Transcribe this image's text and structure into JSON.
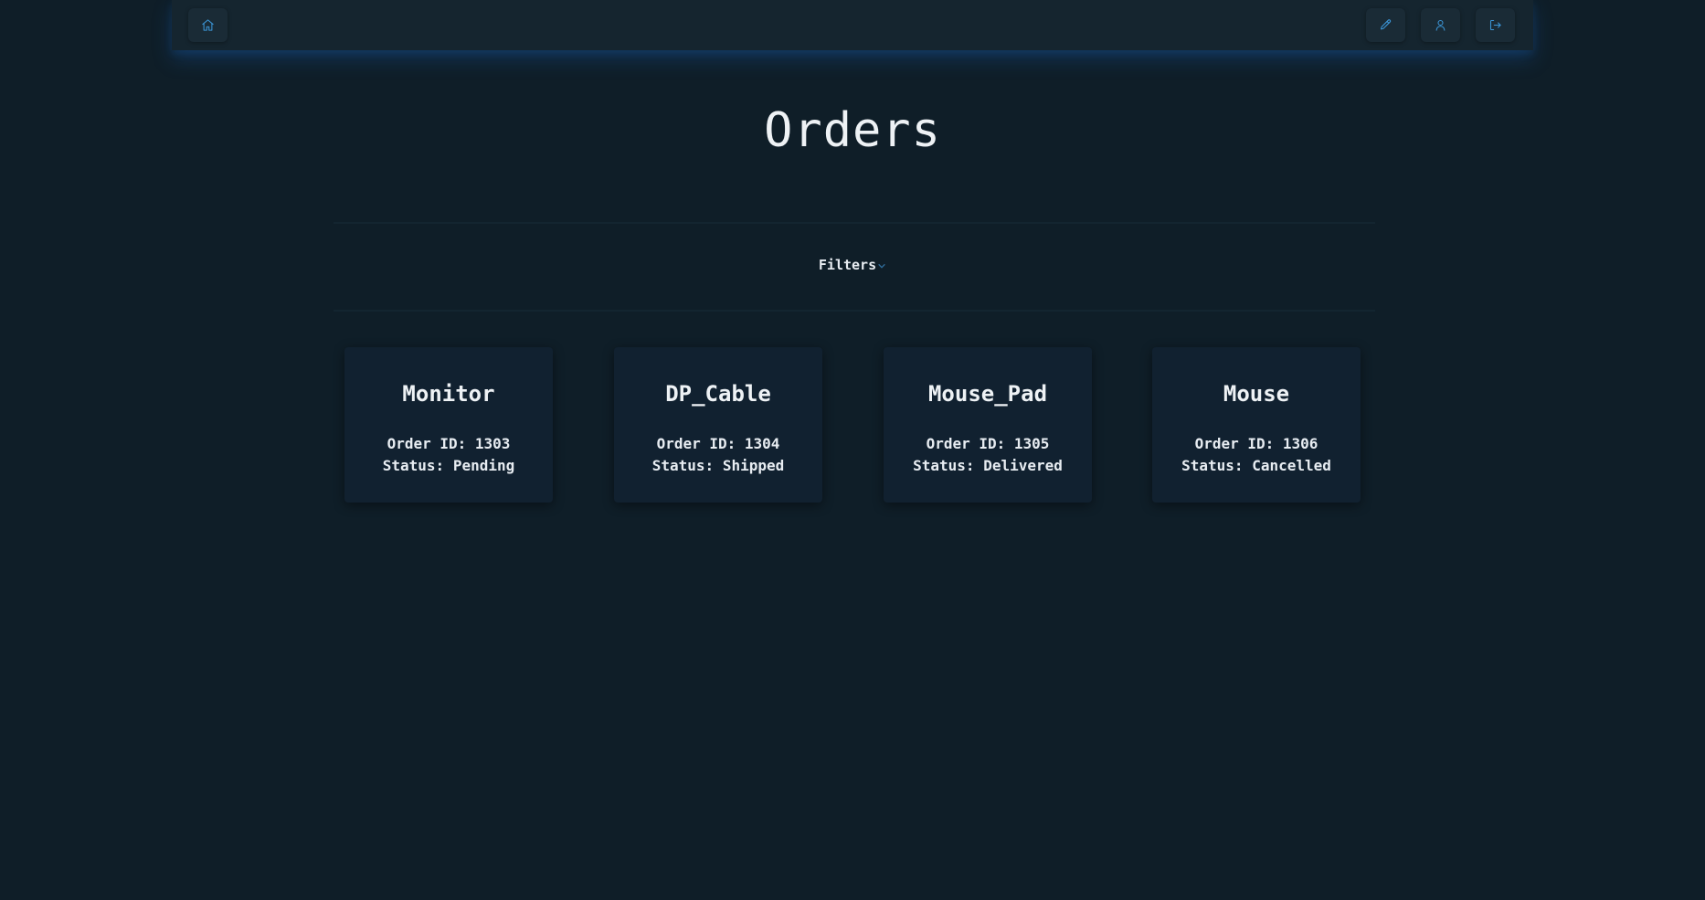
{
  "navbar": {
    "home": {
      "icon": "home-icon"
    },
    "edit": {
      "icon": "pencil-icon"
    },
    "profile": {
      "icon": "user-icon"
    },
    "logout": {
      "icon": "logout-icon"
    },
    "accent_color": "#3b95d6"
  },
  "page": {
    "title": "Orders"
  },
  "filters": {
    "label": "Filters",
    "expanded": false
  },
  "orders": [
    {
      "name": "Monitor",
      "id_label": "Order ID:",
      "id": "1303",
      "status_label": "Status:",
      "status": "Pending"
    },
    {
      "name": "DP_Cable",
      "id_label": "Order ID:",
      "id": "1304",
      "status_label": "Status:",
      "status": "Shipped"
    },
    {
      "name": "Mouse_Pad",
      "id_label": "Order ID:",
      "id": "1305",
      "status_label": "Status:",
      "status": "Delivered"
    },
    {
      "name": "Mouse",
      "id_label": "Order ID:",
      "id": "1306",
      "status_label": "Status:",
      "status": "Cancelled"
    }
  ],
  "colors": {
    "background": "#0f1e28",
    "navbar": "#15252f",
    "card": "#112130",
    "text": "#e8edf2"
  }
}
